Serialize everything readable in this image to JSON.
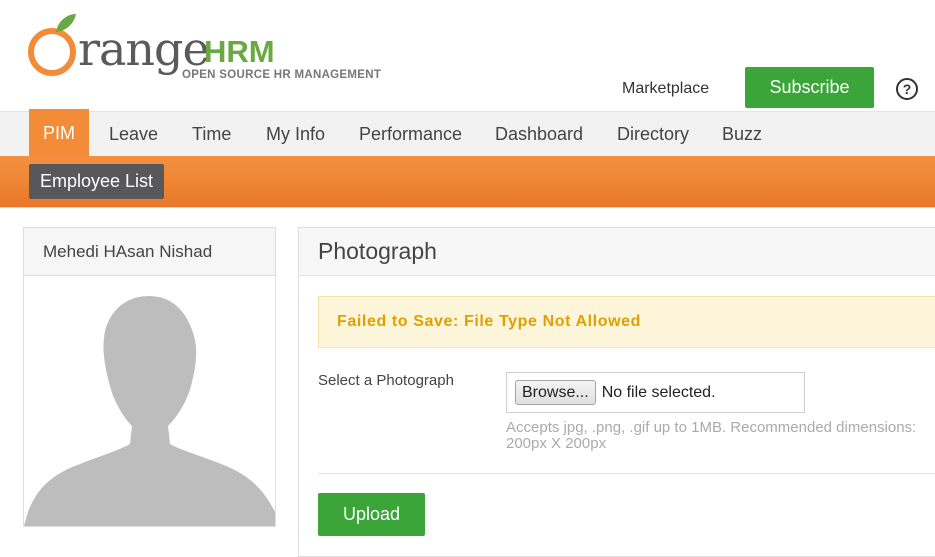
{
  "brand": {
    "word": "range",
    "suffix": "HRM",
    "tagline": "OPEN SOURCE HR MANAGEMENT",
    "colors": {
      "orange": "#f28c38",
      "green": "#6aa842"
    }
  },
  "header": {
    "marketplace_label": "Marketplace",
    "subscribe_label": "Subscribe",
    "help_icon": "help-circle-icon",
    "help_glyph": "?"
  },
  "nav": {
    "items": [
      {
        "label": "PIM",
        "active": true
      },
      {
        "label": "Leave"
      },
      {
        "label": "Time"
      },
      {
        "label": "My Info"
      },
      {
        "label": "Performance"
      },
      {
        "label": "Dashboard"
      },
      {
        "label": "Directory"
      },
      {
        "label": "Buzz"
      }
    ]
  },
  "subnav": {
    "items": [
      {
        "label": "Employee List"
      }
    ]
  },
  "profile": {
    "name": "Mehedi HAsan Nishad",
    "photo_icon": "default-avatar-silhouette"
  },
  "photograph": {
    "title": "Photograph",
    "error_message": "Failed to Save: File Type Not Allowed",
    "field_label": "Select a Photograph",
    "browse_label": "Browse...",
    "file_status": "No file selected.",
    "hint": "Accepts jpg, .png, .gif up to 1MB. Recommended dimensions: 200px X 200px",
    "upload_label": "Upload"
  },
  "colors": {
    "accent": "#f28c38",
    "button_green": "#3ba53a",
    "alert_bg": "#fcf5d9",
    "alert_text": "#e0a000",
    "subnav_button": "#58575a"
  }
}
